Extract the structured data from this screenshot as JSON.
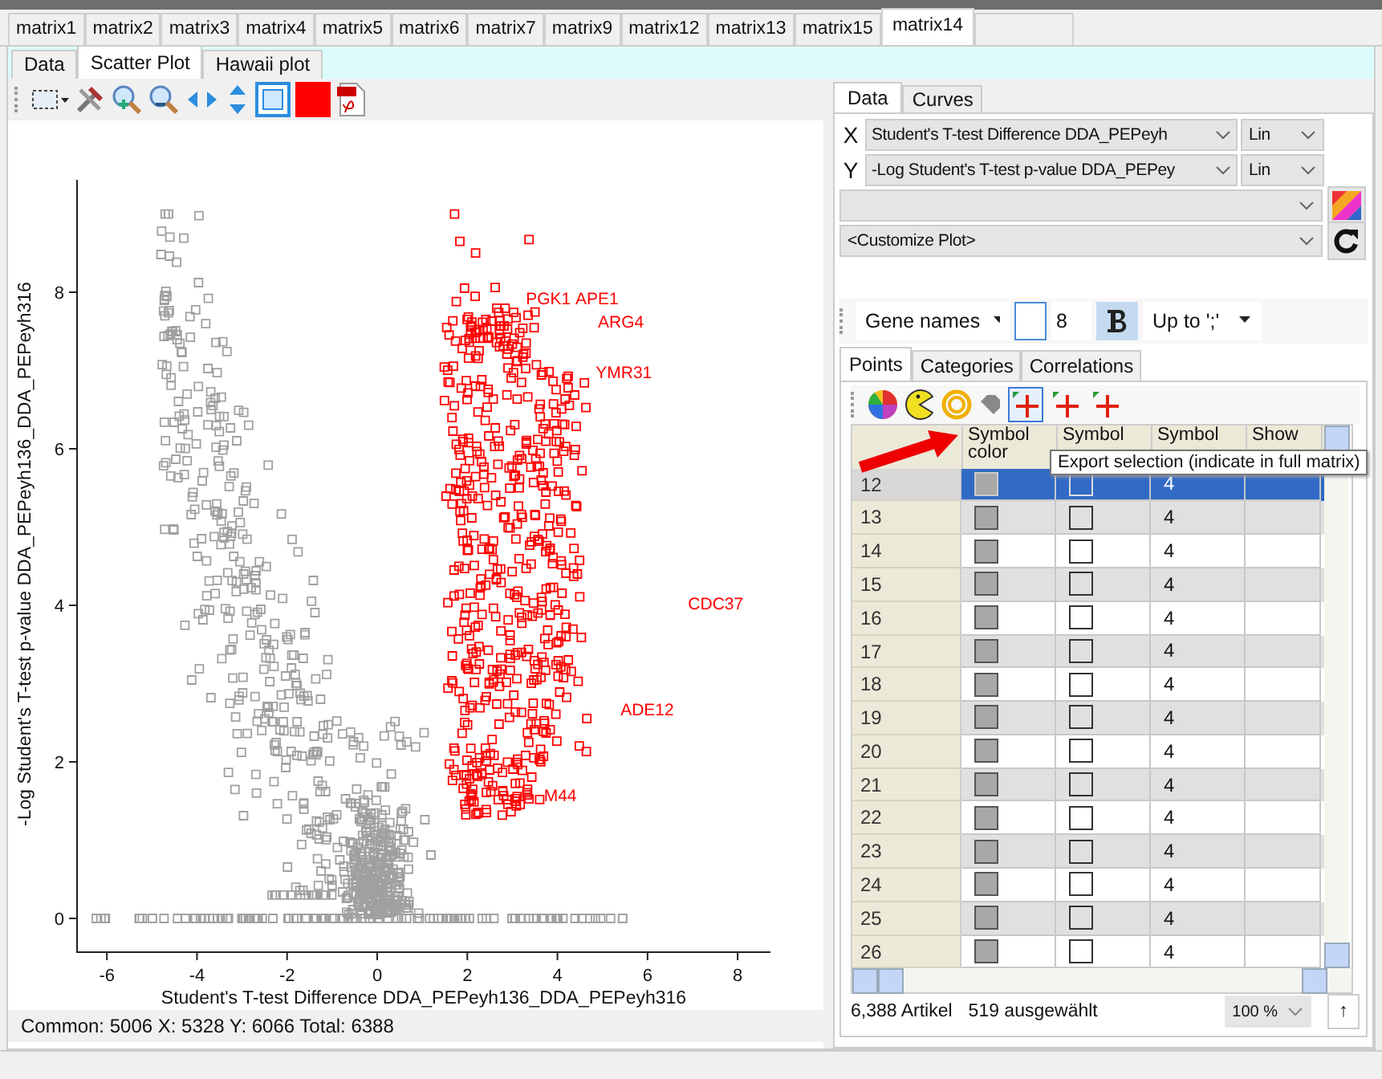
{
  "matrix_tabs": [
    {
      "label": "matrix1",
      "selected": false
    },
    {
      "label": "matrix2",
      "selected": false
    },
    {
      "label": "matrix3",
      "selected": false
    },
    {
      "label": "matrix4",
      "selected": false
    },
    {
      "label": "matrix5",
      "selected": false
    },
    {
      "label": "matrix6",
      "selected": false
    },
    {
      "label": "matrix7",
      "selected": false
    },
    {
      "label": "matrix9",
      "selected": false
    },
    {
      "label": "matrix12",
      "selected": false
    },
    {
      "label": "matrix13",
      "selected": false
    },
    {
      "label": "matrix15",
      "selected": false
    },
    {
      "label": "matrix14",
      "selected": true
    }
  ],
  "view_tabs": [
    {
      "label": "Data",
      "selected": false
    },
    {
      "label": "Scatter Plot",
      "selected": true
    },
    {
      "label": "Hawaii plot",
      "selected": false
    }
  ],
  "plot": {
    "x_axis_title": "Student's T-test Difference DDA_PEPeyh136_DDA_PEPeyh316",
    "y_axis_title": "-Log Student's T-test p-value DDA_PEPeyh136_DDA_PEPeyh316",
    "x_ticks": [
      "-6",
      "-4",
      "-2",
      "0",
      "2",
      "4",
      "6",
      "8"
    ],
    "y_ticks": [
      "8",
      "6",
      "4",
      "2",
      "0"
    ],
    "gene_labels": [
      "PGK1",
      "APE1",
      "ARG4",
      "YMR31",
      "CDC37",
      "ADE12",
      "M44"
    ]
  },
  "plot_status": "Common: 5006  X: 5328  Y: 6066  Total: 6388",
  "panel_tabs": [
    {
      "label": "Data",
      "selected": true
    },
    {
      "label": "Curves",
      "selected": false
    }
  ],
  "axes": [
    {
      "axis": "X",
      "column": "Student's T-test Difference DDA_PEPeyh",
      "scale": "Lin"
    },
    {
      "axis": "Y",
      "column": "-Log Student's T-test p-value DDA_PEPey",
      "scale": "Lin"
    }
  ],
  "customize": "<Customize Plot>",
  "label_toolbar": {
    "column": "Gene names",
    "font_size": "8",
    "bold": true,
    "mode": "Up to ';'"
  },
  "table_tabs": [
    {
      "label": "Points",
      "selected": true
    },
    {
      "label": "Categories",
      "selected": false
    },
    {
      "label": "Correlations",
      "selected": false
    }
  ],
  "export_buttons": [
    {
      "hovered": true
    },
    {
      "hovered": false
    },
    {
      "hovered": false
    }
  ],
  "table": {
    "columns": [
      "Symbol color",
      "Symbol",
      "Symbol",
      "Show"
    ],
    "rows": [
      {
        "row": "12",
        "size": "4",
        "selected": true
      },
      {
        "row": "13",
        "size": "4",
        "selected": false
      },
      {
        "row": "14",
        "size": "4",
        "selected": false
      },
      {
        "row": "15",
        "size": "4",
        "selected": false
      },
      {
        "row": "16",
        "size": "4",
        "selected": false
      },
      {
        "row": "17",
        "size": "4",
        "selected": false
      },
      {
        "row": "18",
        "size": "4",
        "selected": false
      },
      {
        "row": "19",
        "size": "4",
        "selected": false
      },
      {
        "row": "20",
        "size": "4",
        "selected": false
      },
      {
        "row": "21",
        "size": "4",
        "selected": false
      },
      {
        "row": "22",
        "size": "4",
        "selected": false
      },
      {
        "row": "23",
        "size": "4",
        "selected": false
      },
      {
        "row": "24",
        "size": "4",
        "selected": false
      },
      {
        "row": "25",
        "size": "4",
        "selected": false
      },
      {
        "row": "26",
        "size": "4",
        "selected": false
      }
    ]
  },
  "tooltip": "Export selection (indicate in full matrix)",
  "table_status": {
    "count": "6,388 Artikel",
    "selected": "519 ausgewählt",
    "zoom": "100 %",
    "up_button": "↑"
  }
}
